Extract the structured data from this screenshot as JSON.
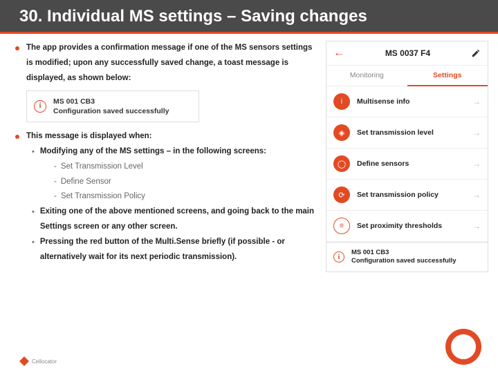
{
  "title": "30. Individual MS settings – Saving changes",
  "p1": "The app provides a confirmation message if one of the MS sensors settings is modified; upon any successfully saved change, a toast message is displayed, as shown below:",
  "toast": {
    "line1": "MS 001 CB3",
    "line2": "Configuration saved successfully"
  },
  "p2": "This message is displayed when:",
  "s1": "Modifying any of the MS settings – in the following screens:",
  "s1a": "Set Transmission Level",
  "s1b": "Define Sensor",
  "s1c": "Set Transmission Policy",
  "s2": "Exiting one of the above mentioned screens, and going back to the main Settings screen or any other screen.",
  "s3": "Pressing the red button of the Multi.Sense briefly (if possible - or alternatively wait for its next periodic transmission).",
  "phone": {
    "title": "MS 0037 F4",
    "tab_monitoring": "Monitoring",
    "tab_settings": "Settings",
    "rows": {
      "r0": "Multisense info",
      "r1": "Set transmission level",
      "r2": "Define sensors",
      "r3": "Set transmission policy",
      "r4": "Set proximity thresholds"
    },
    "toast1": "MS 001 CB3",
    "toast2": "Configuration saved successfully"
  },
  "logo": "Cellocator"
}
